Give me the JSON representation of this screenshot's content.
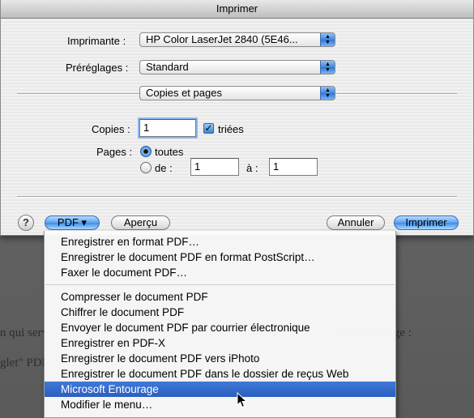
{
  "window": {
    "title": "Imprimer"
  },
  "printer": {
    "label": "Imprimante :",
    "value": "HP Color LaserJet 2840 (5E46..."
  },
  "presets": {
    "label": "Préréglages :",
    "value": "Standard"
  },
  "panel": {
    "value": "Copies et pages"
  },
  "copies": {
    "label": "Copies :",
    "value": "1",
    "collated_label": "triées",
    "collated_checked": true
  },
  "pages": {
    "label": "Pages :",
    "all_label": "toutes",
    "range_label": "de :",
    "from_value": "1",
    "to_label": "à :",
    "to_value": "1",
    "selected": "all"
  },
  "buttons": {
    "help": "?",
    "pdf": "PDF ▾",
    "preview": "Aperçu",
    "cancel": "Annuler",
    "print": "Imprimer"
  },
  "pdf_menu": {
    "group1": [
      "Enregistrer en format PDF…",
      "Enregistrer le document PDF en format PostScript…",
      "Faxer le document PDF…"
    ],
    "group2": [
      "Compresser le document PDF",
      "Chiffrer le document PDF",
      "Envoyer le document PDF par courrier électronique",
      "Enregistrer en PDF-X",
      "Enregistrer le document PDF vers iPhoto",
      "Enregistrer le document PDF dans le dossier de reçus Web",
      "Microsoft Entourage",
      "Modifier le menu…"
    ],
    "selected_item": "Microsoft Entourage"
  },
  "background": {
    "line1_left": "n qui servi",
    "line1_right": "oft Entourage :",
    "line2_left": "glet\" PDF"
  },
  "colors": {
    "accent": "#3b86d8",
    "menu_highlight": "#2b5fc0"
  }
}
